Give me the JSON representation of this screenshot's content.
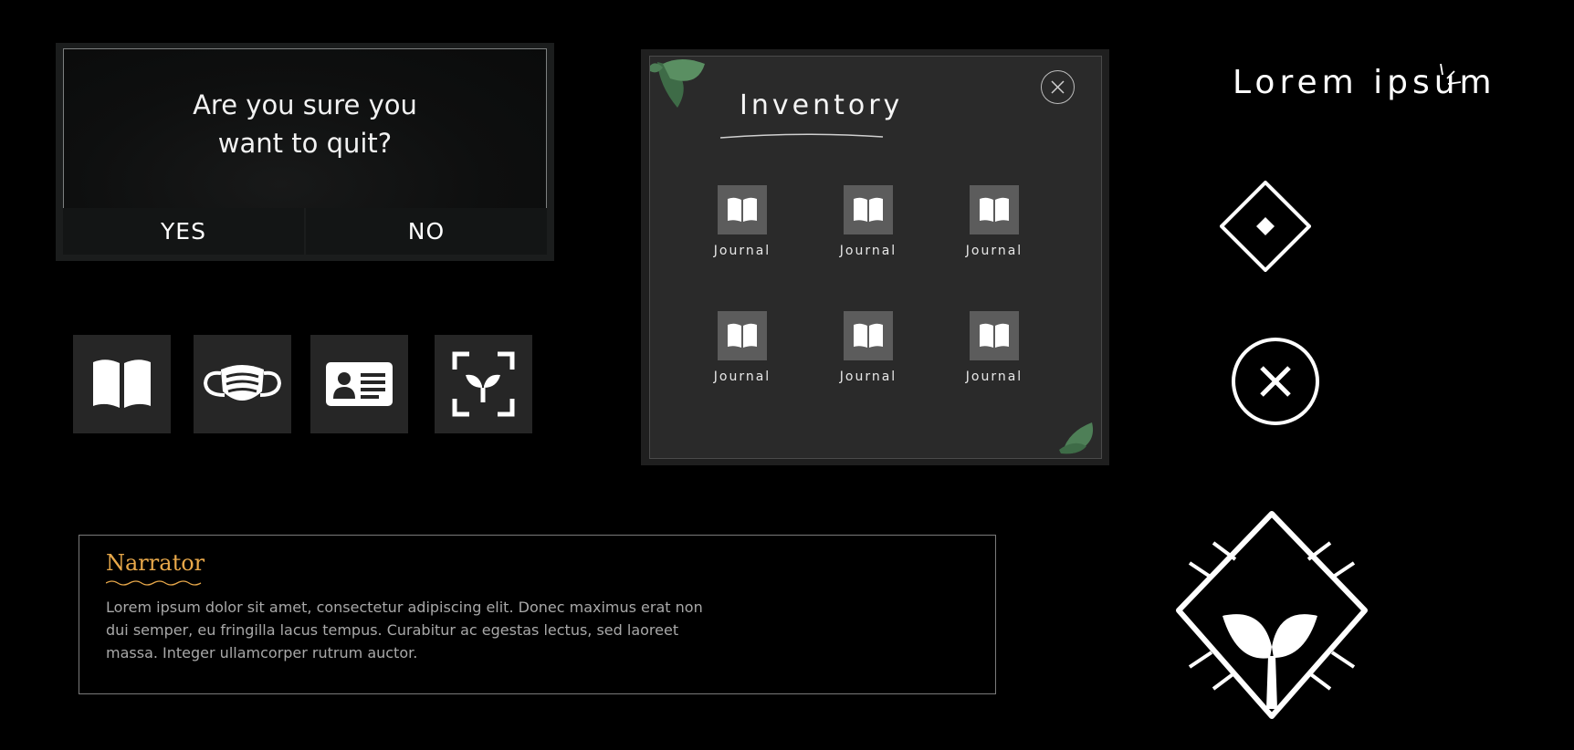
{
  "quit_dialog": {
    "message": "Are you sure you\nwant to quit?",
    "yes_label": "YES",
    "no_label": "NO"
  },
  "item_slots": [
    {
      "icon": "open-book-icon"
    },
    {
      "icon": "face-mask-icon"
    },
    {
      "icon": "id-card-icon"
    },
    {
      "icon": "scan-plant-icon"
    }
  ],
  "inventory": {
    "title": "Inventory",
    "close_icon": "close-icon",
    "items": [
      {
        "label": "Journal",
        "icon": "journal-icon"
      },
      {
        "label": "Journal",
        "icon": "journal-icon"
      },
      {
        "label": "Journal",
        "icon": "journal-icon"
      },
      {
        "label": "Journal",
        "icon": "journal-icon"
      },
      {
        "label": "Journal",
        "icon": "journal-icon"
      },
      {
        "label": "Journal",
        "icon": "journal-icon"
      }
    ]
  },
  "narrator": {
    "name": "Narrator",
    "text": "Lorem ipsum dolor sit amet, consectetur adipiscing elit. Donec maximus erat non dui semper, eu fringilla lacus tempus. Curabitur ac egestas lectus, sed laoreet massa. Integer ullamcorper rutrum auctor."
  },
  "right_panel": {
    "title": "Lorem ipsum",
    "icons": [
      "diamond-icon",
      "close-circle-icon",
      "sprout-emblem-icon"
    ]
  },
  "colors": {
    "background": "#000000",
    "panel": "#2a2a2a",
    "narrator_name": "#e8a84a",
    "leaf": "#4e7f57"
  }
}
